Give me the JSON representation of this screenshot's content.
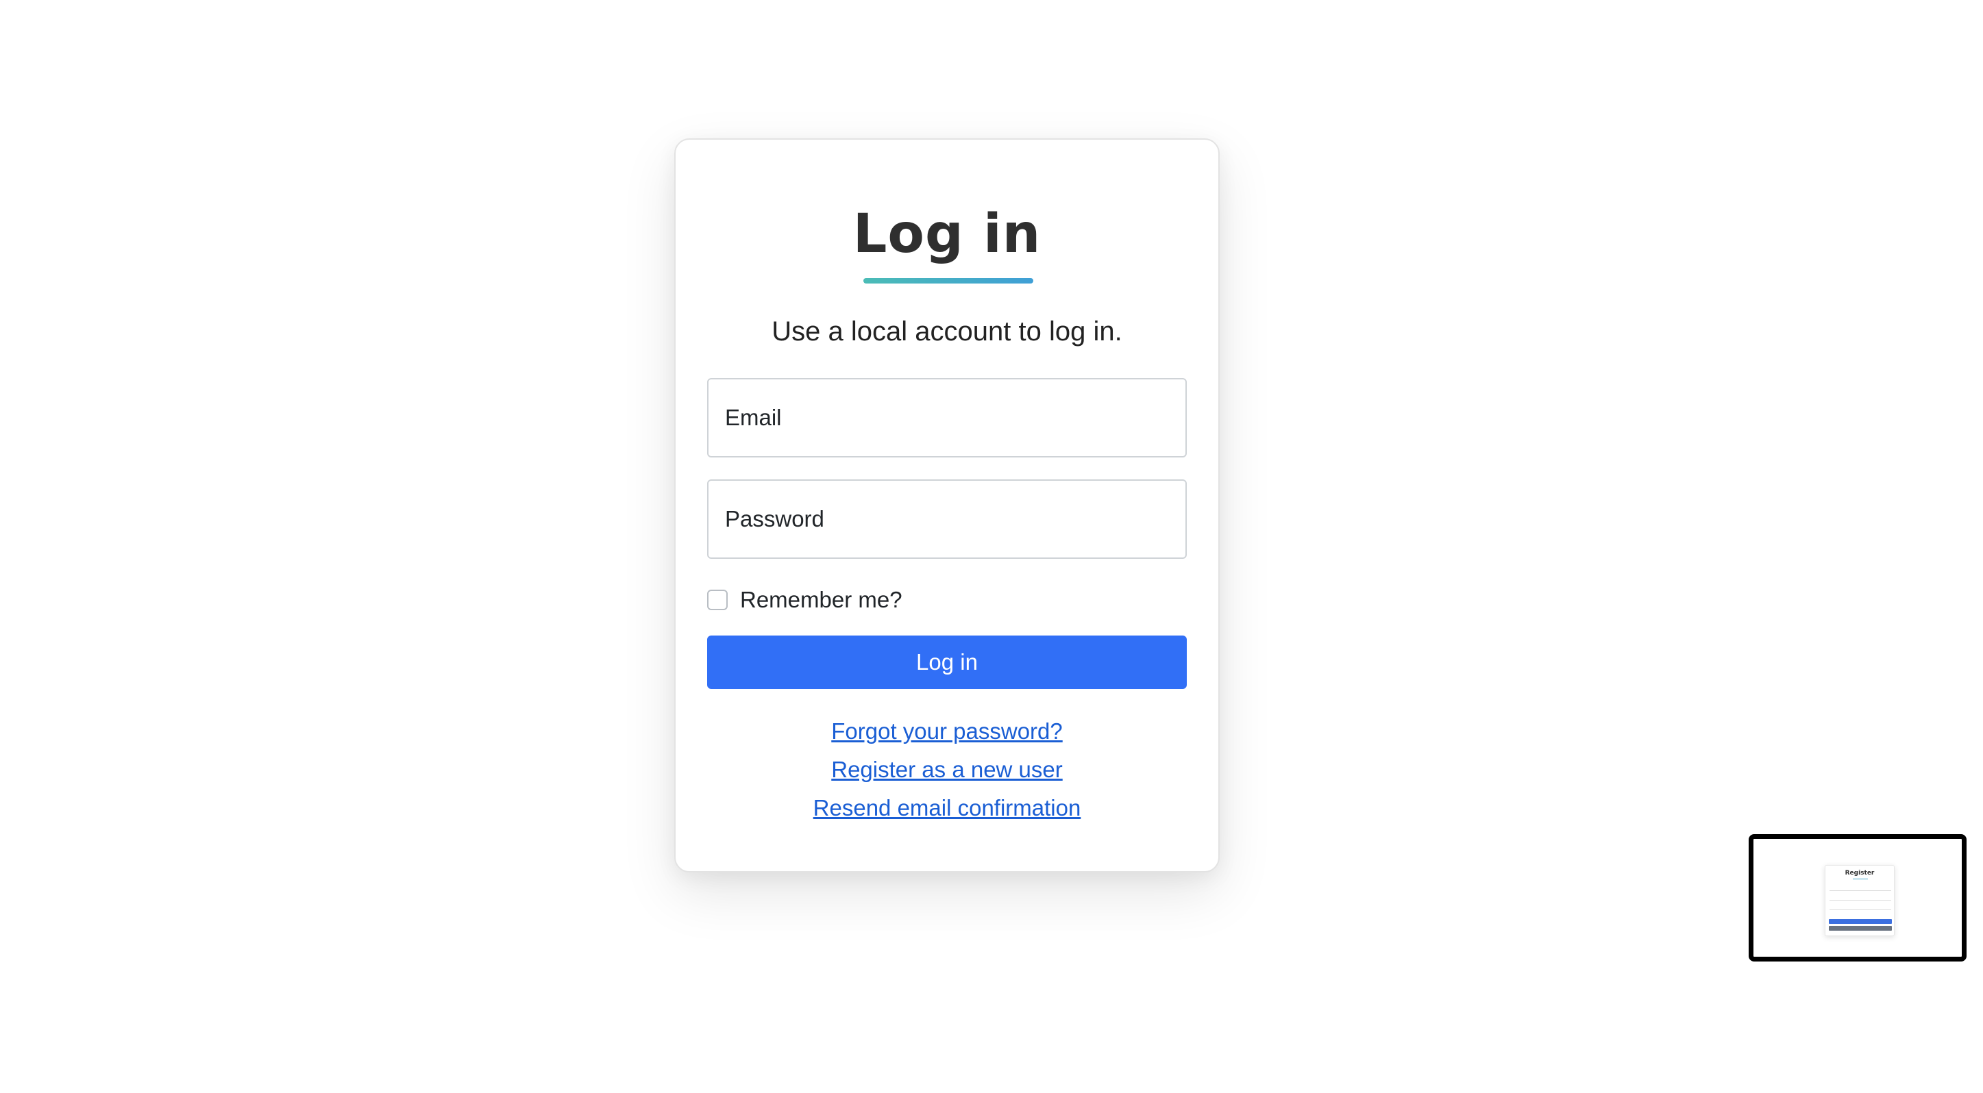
{
  "login": {
    "title": "Log in",
    "subtitle": "Use a local account to log in.",
    "email_placeholder": "Email",
    "password_placeholder": "Password",
    "remember_label": "Remember me?",
    "remember_checked": false,
    "submit_label": "Log in",
    "links": {
      "forgot_password": "Forgot your password?",
      "register": "Register as a new user",
      "resend_confirmation": "Resend email confirmation"
    }
  },
  "colors": {
    "primary_button": "#316ff6",
    "link": "#1a5ed4",
    "title_underline_start": "#4bbcb6",
    "title_underline_end": "#3f9fd6"
  },
  "preview_thumbnail": {
    "title": "Register"
  }
}
